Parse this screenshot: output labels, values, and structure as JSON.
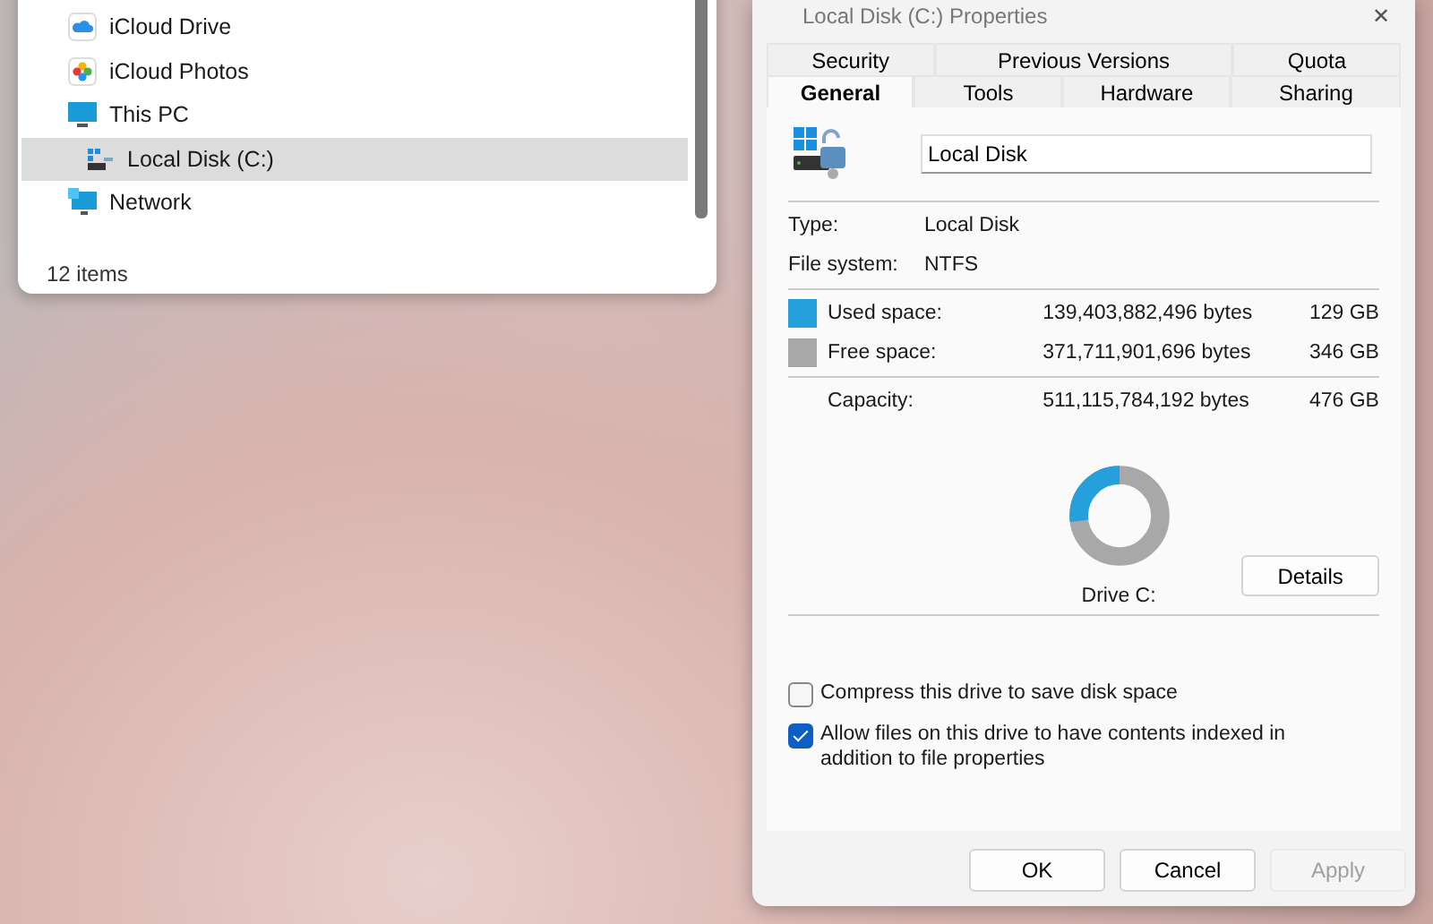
{
  "explorer": {
    "nav": [
      {
        "label": "iCloud Drive",
        "kind": "cloud",
        "selected": false
      },
      {
        "label": "iCloud Photos",
        "kind": "photos",
        "selected": false
      },
      {
        "label": "This PC",
        "kind": "pc",
        "selected": false,
        "children": [
          {
            "label": "Local Disk (C:)",
            "kind": "disk",
            "selected": true
          }
        ]
      },
      {
        "label": "Network",
        "kind": "network",
        "selected": false
      }
    ],
    "status_bar": "12 items"
  },
  "dialog": {
    "title": "Local Disk (C:) Properties",
    "close": "✕",
    "tab_rows": [
      [
        {
          "label": "Security",
          "selected": false
        },
        {
          "label": "Previous Versions",
          "selected": false
        },
        {
          "label": "Quota",
          "selected": false
        }
      ],
      [
        {
          "label": "General",
          "selected": true
        },
        {
          "label": "Tools",
          "selected": false
        },
        {
          "label": "Hardware",
          "selected": false
        },
        {
          "label": "Sharing",
          "selected": false
        }
      ]
    ],
    "name_field": "Local Disk",
    "info": [
      {
        "label": "Type:",
        "value": "Local Disk"
      },
      {
        "label": "File system:",
        "value": "NTFS"
      }
    ],
    "space": [
      {
        "label": "Used space:",
        "bytes": "139,403,882,496 bytes",
        "size": "129 GB",
        "color": "#26a0da"
      },
      {
        "label": "Free space:",
        "bytes": "371,711,901,696 bytes",
        "size": "346 GB",
        "color": "#a8a8a8"
      }
    ],
    "capacity": {
      "label": "Capacity:",
      "bytes": "511,115,784,192 bytes",
      "size": "476 GB",
      "level": 0.27
    },
    "drive_label": "Drive C:",
    "details_button": "Details",
    "options": [
      {
        "label": "Compress this drive to save disk space",
        "checked": false
      },
      {
        "label": "Allow files on this drive to have contents indexed in addition to file properties",
        "checked": true
      }
    ],
    "buttons": [
      {
        "label": "OK",
        "disabled": false
      },
      {
        "label": "Cancel",
        "disabled": false
      },
      {
        "label": "Apply",
        "disabled": true
      }
    ]
  }
}
